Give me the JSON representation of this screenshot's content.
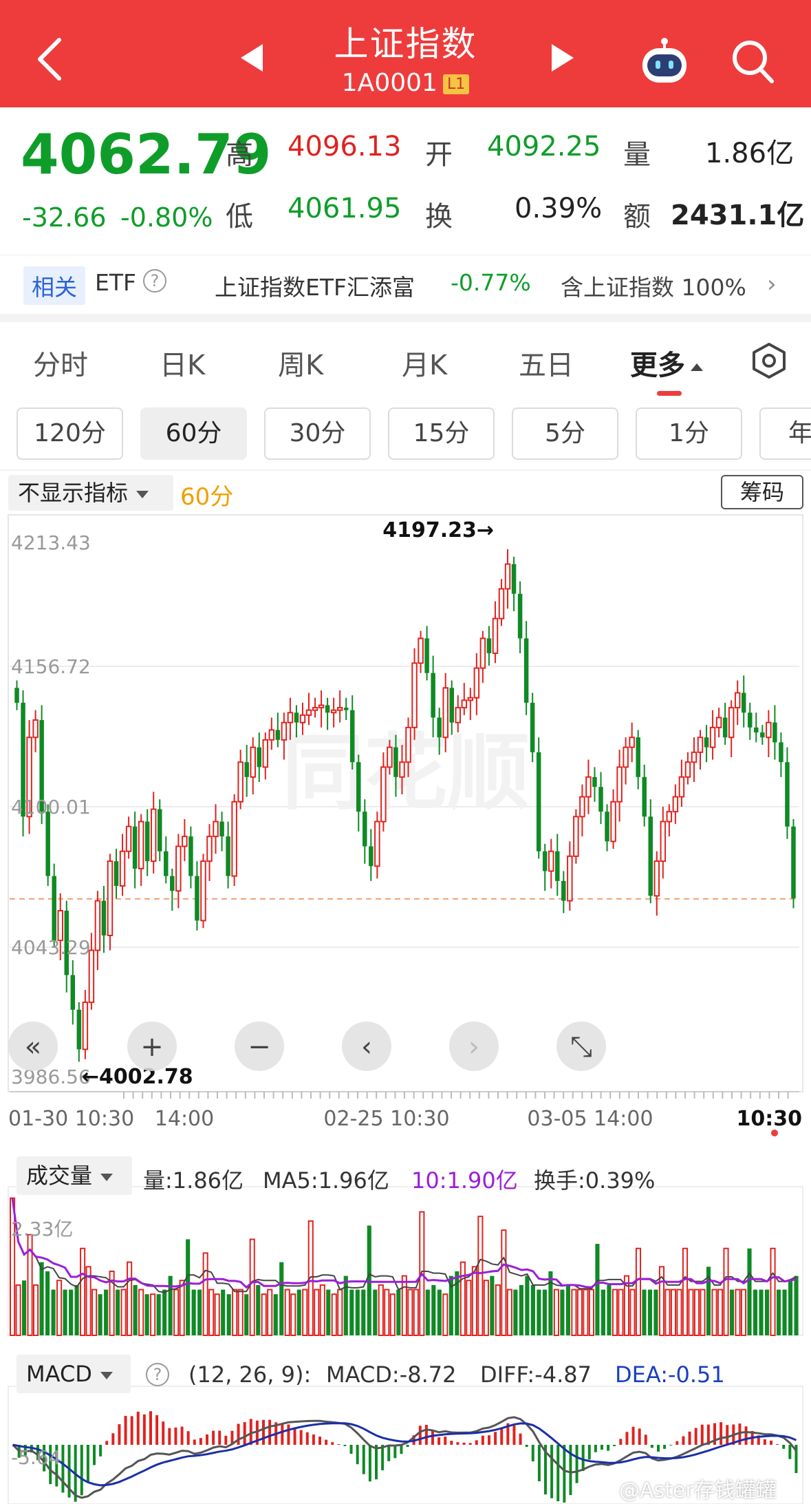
{
  "header": {
    "title": "上证指数",
    "code": "1A0001",
    "level_badge": "L1"
  },
  "quote": {
    "price": "4062.79",
    "change": "-32.66",
    "change_pct": "-0.80%",
    "high_label": "高",
    "high": "4096.13",
    "open_label": "开",
    "open": "4092.25",
    "vol_label": "量",
    "volume": "1.86亿",
    "low_label": "低",
    "low": "4061.95",
    "turn_label": "换",
    "turnover": "0.39%",
    "amt_label": "额",
    "amount": "2431.1亿"
  },
  "related": {
    "tag": "相关",
    "type": "ETF",
    "help": "?",
    "name": "上证指数ETF汇添富",
    "pct": "-0.77%",
    "holding": "含上证指数",
    "holding_pct": "100%",
    "chevron": "›"
  },
  "tabs": [
    {
      "label": "分时",
      "active": false
    },
    {
      "label": "日K",
      "active": false
    },
    {
      "label": "周K",
      "active": false
    },
    {
      "label": "月K",
      "active": false
    },
    {
      "label": "五日",
      "active": false
    },
    {
      "label": "更多",
      "active": true
    }
  ],
  "chips": [
    "120分",
    "60分",
    "30分",
    "15分",
    "5分",
    "1分",
    "年"
  ],
  "selected_chip": "60分",
  "indicator": {
    "select_label": "不显示指标",
    "period": "60分",
    "chip_button": "筹码"
  },
  "chart_data": {
    "type": "candlestick",
    "y_ticks": [
      "4213.43",
      "4156.72",
      "4100.01",
      "4043.29",
      "3986.56"
    ],
    "ylim": [
      3986.56,
      4213.43
    ],
    "x_ticks": [
      "01-30 10:30",
      "14:00",
      "02-25 10:30",
      "03-05 14:00",
      "10:30"
    ],
    "max_annotation": "4197.23→",
    "min_annotation": "←4002.78",
    "last_price": 4062.79,
    "up_color": "#e0231f",
    "down_color": "#0f8a25",
    "closes": [
      4142,
      4096,
      4128,
      4135,
      4098,
      4072,
      4046,
      4058,
      4032,
      4018,
      4002,
      4021,
      4042,
      4062,
      4048,
      4078,
      4068,
      4082,
      4092,
      4075,
      4094,
      4078,
      4099,
      4082,
      4072,
      4066,
      4084,
      4088,
      4072,
      4054,
      4078,
      4088,
      4094,
      4088,
      4072,
      4102,
      4118,
      4112,
      4124,
      4116,
      4127,
      4131,
      4127,
      4134,
      4138,
      4134,
      4137,
      4139,
      4140,
      4141,
      4138,
      4139,
      4140,
      4139,
      4118,
      4098,
      4084,
      4076,
      4094,
      4116,
      4124,
      4112,
      4118,
      4132,
      4158,
      4168,
      4154,
      4136,
      4128,
      4148,
      4134,
      4140,
      4143,
      4144,
      4156,
      4168,
      4162,
      4176,
      4188,
      4198,
      4186,
      4168,
      4142,
      4122,
      4082,
      4074,
      4082,
      4070,
      4062,
      4080,
      4096,
      4104,
      4112,
      4108,
      4098,
      4086,
      4102,
      4116,
      4124,
      4128,
      4112,
      4096,
      4064,
      4078,
      4094,
      4098,
      4104,
      4112,
      4118,
      4122,
      4128,
      4124,
      4132,
      4136,
      4128,
      4140,
      4146,
      4138,
      4132,
      4130,
      4128,
      4134,
      4126,
      4118,
      4092,
      4063
    ]
  },
  "chart_controls": [
    "«",
    "+",
    "−",
    "‹",
    "›",
    "⤡"
  ],
  "volume": {
    "select_label": "成交量",
    "vol": "量:1.86亿",
    "ma5": "MA5:1.96亿",
    "ma10": "10:1.90亿",
    "turnover": "换手:0.39%",
    "y_tick": "2.33亿",
    "values": [
      3.0,
      1.1,
      1.2,
      2.2,
      1.1,
      1.6,
      1.4,
      1.0,
      1.2,
      1.0,
      1.0,
      1.1,
      1.9,
      1.5,
      1.0,
      0.9,
      1.0,
      1.4,
      1.0,
      1.0,
      1.6,
      1.1,
      1.0,
      0.9,
      0.9,
      0.9,
      1.0,
      1.3,
      1.0,
      1.2,
      2.1,
      1.0,
      1.0,
      1.8,
      1.0,
      0.9,
      1.0,
      0.9,
      1.0,
      1.0,
      0.9,
      2.1,
      1.1,
      0.9,
      1.0,
      0.9,
      1.6,
      1.0,
      0.9,
      1.0,
      1.0,
      2.5,
      1.0,
      1.1,
      1.0,
      0.9,
      1.0,
      1.3,
      1.0,
      1.0,
      1.0,
      2.4,
      1.0,
      1.1,
      1.0,
      0.9,
      1.0,
      1.3,
      1.0,
      1.0,
      2.7,
      1.0,
      1.1,
      1.0,
      0.9,
      1.3,
      1.4,
      1.6,
      1.2,
      1.5,
      2.6,
      1.2,
      1.3,
      1.1,
      2.3,
      1.0,
      1.0,
      1.1,
      1.3,
      1.1,
      1.0,
      1.0,
      1.4,
      1.0,
      1.0,
      1.1,
      1.0,
      1.0,
      1.0,
      1.0,
      2.0,
      1.0,
      1.1,
      1.0,
      1.0,
      1.3,
      1.0,
      1.9,
      1.0,
      1.0,
      1.0,
      1.5,
      1.0,
      1.0,
      1.0,
      1.9,
      1.0,
      1.0,
      1.0,
      1.5,
      1.0,
      1.0,
      1.9,
      1.0,
      1.0,
      1.0,
      1.9,
      1.0,
      1.0,
      1.0,
      1.9,
      1.0,
      1.0,
      1.2,
      1.3
    ]
  },
  "macd": {
    "select_label": "MACD",
    "help": "?",
    "params": "(12, 26, 9):",
    "macd": "MACD:-8.72",
    "diff": "DIFF:-4.87",
    "dea": "DEA:-0.51",
    "y_tick": "-5.64"
  },
  "watermark": {
    "brand": "同花顺",
    "credit": "@Aster存钱罐罐"
  }
}
